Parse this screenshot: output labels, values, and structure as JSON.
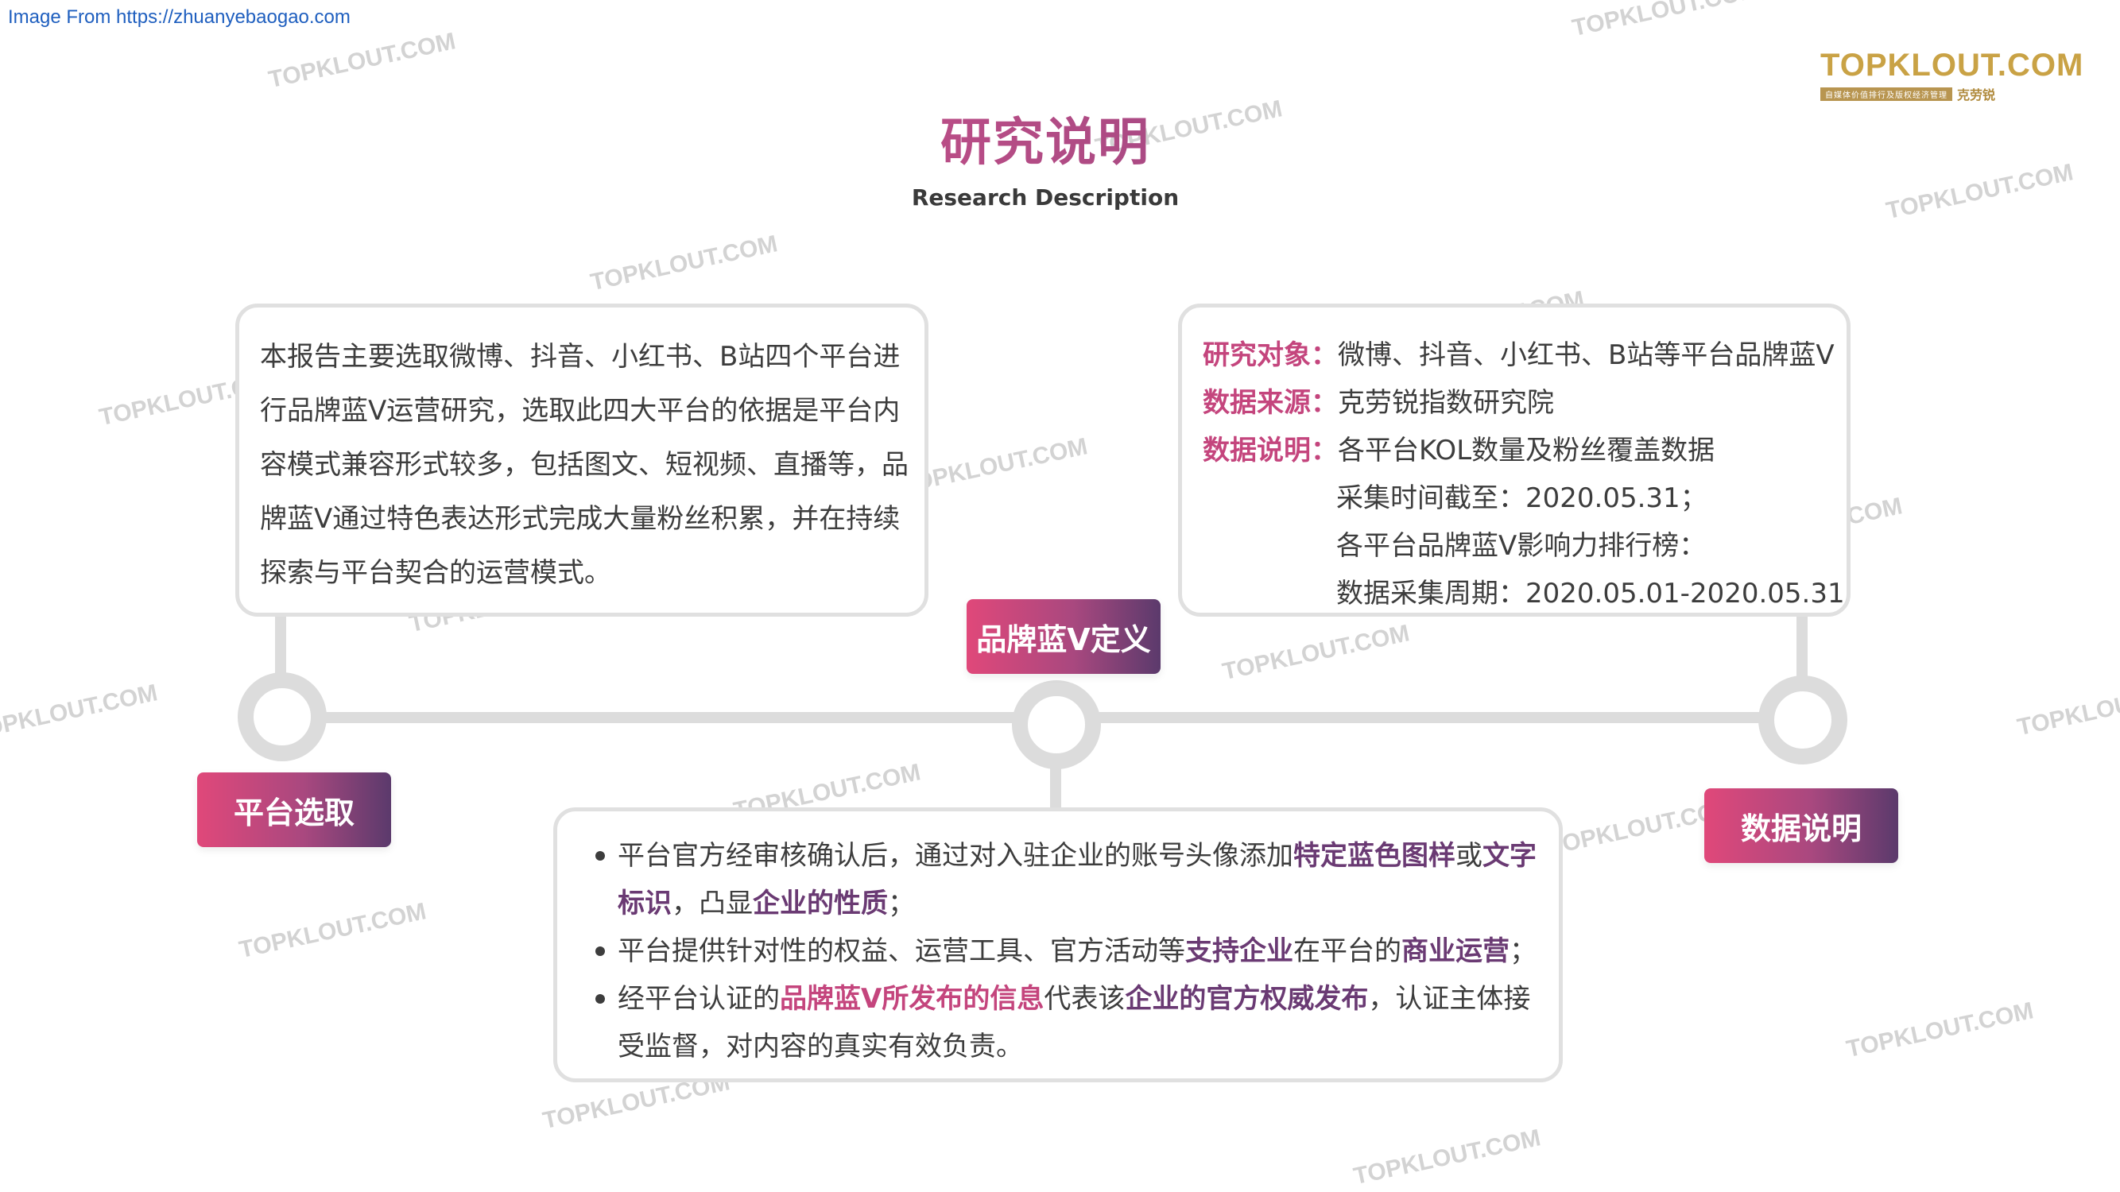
{
  "source_note": "Image From https://zhuanyebaogao.com",
  "logo": {
    "text": "TOPKLOUT.COM",
    "tagline": "自媒体价值排行及版权经济管理",
    "cn_name": "克劳锐"
  },
  "title": "研究说明",
  "subtitle": "Research Description",
  "labels": {
    "platform": "平台选取",
    "definition": "品牌蓝V定义",
    "data": "数据说明"
  },
  "platform_text": "本报告主要选取微博、抖音、小红书、B站四个平台进行品牌蓝V运营研究，选取此四大平台的依据是平台内容模式兼容形式较多，包括图文、短视频、直播等，品牌蓝V通过特色表达形式完成大量粉丝积累，并在持续探索与平台契合的运营模式。",
  "data_info": {
    "object_key": "研究对象：",
    "object_val": "微博、抖音、小红书、B站等平台品牌蓝V",
    "source_key": "数据来源：",
    "source_val": "克劳锐指数研究院",
    "desc_key": "数据说明：",
    "desc_val_1": "各平台KOL数量及粉丝覆盖数据",
    "desc_val_2": "采集时间截至：2020.05.31；",
    "desc_val_3": "各平台品牌蓝V影响力排行榜：",
    "desc_val_4": "数据采集周期：2020.05.01-2020.05.31"
  },
  "definition_bullets": {
    "b1_a": "平台官方经审核确认后，通过对入驻企业的账号头像添加",
    "b1_b": "特定蓝色图样",
    "b1_c": "或",
    "b1_d": "文字标识",
    "b1_e": "，凸显",
    "b1_f": "企业的性质",
    "b1_g": "；",
    "b2_a": "平台提供针对性的权益、运营工具、官方活动等",
    "b2_b": "支持企业",
    "b2_c": "在平台的",
    "b2_d": "商业运营",
    "b2_e": "；",
    "b3_a": "经平台认证的",
    "b3_b": "品牌蓝V所发布的信息",
    "b3_c": "代表该",
    "b3_d": "企业的官方权威发布",
    "b3_e": "，认证主体接受监督，对内容的真实有效负责。"
  },
  "watermark": "TOPKLOUT.COM",
  "colors": {
    "accent_pink": "#c4457d",
    "accent_purple": "#6a3a73",
    "timeline_gray": "#dcdcdc",
    "logo_gold": "#c9a245"
  }
}
